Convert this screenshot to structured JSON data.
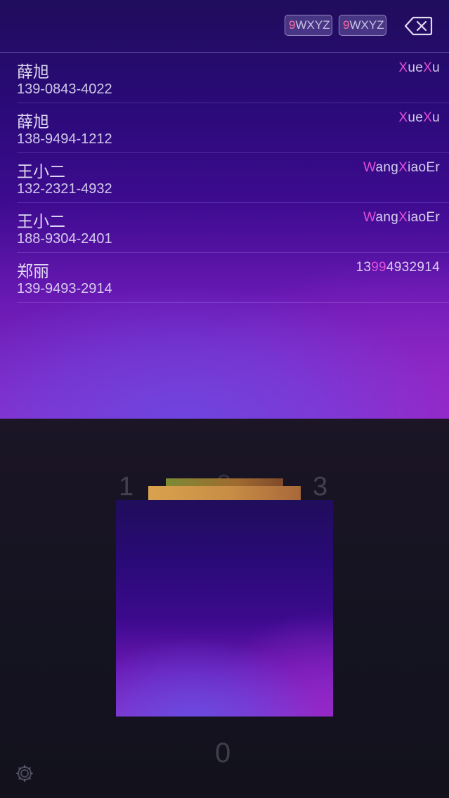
{
  "search": {
    "chips": [
      {
        "highlight": "9",
        "rest": "WXYZ"
      },
      {
        "highlight": "9",
        "rest": "WXYZ"
      }
    ],
    "backspace_icon": "backspace-icon"
  },
  "results": [
    {
      "name": "薛旭",
      "phone": "139-0843-4022",
      "match": [
        {
          "t": "X",
          "hl": true
        },
        {
          "t": "ue",
          "hl": false
        },
        {
          "t": "X",
          "hl": true
        },
        {
          "t": "u",
          "hl": false
        }
      ]
    },
    {
      "name": "薛旭",
      "phone": "138-9494-1212",
      "match": [
        {
          "t": "X",
          "hl": true
        },
        {
          "t": "ue",
          "hl": false
        },
        {
          "t": "X",
          "hl": true
        },
        {
          "t": "u",
          "hl": false
        }
      ]
    },
    {
      "name": "王小二",
      "phone": "132-2321-4932",
      "match": [
        {
          "t": "W",
          "hl": true
        },
        {
          "t": "ang",
          "hl": false
        },
        {
          "t": "X",
          "hl": true
        },
        {
          "t": "iaoEr",
          "hl": false
        }
      ]
    },
    {
      "name": "王小二",
      "phone": "188-9304-2401",
      "match": [
        {
          "t": "W",
          "hl": true
        },
        {
          "t": "ang",
          "hl": false
        },
        {
          "t": "X",
          "hl": true
        },
        {
          "t": "iaoEr",
          "hl": false
        }
      ]
    },
    {
      "name": "郑丽",
      "phone": "139-9493-2914",
      "match": [
        {
          "t": "13",
          "hl": false
        },
        {
          "t": "99",
          "hl": true
        },
        {
          "t": "4932914",
          "hl": false
        }
      ]
    }
  ],
  "keypad": {
    "visible_digits": {
      "one": "1",
      "two": "2",
      "three": "3",
      "zero": "0"
    },
    "settings_icon": "gear-icon"
  },
  "colors": {
    "accent_highlight": "#e04fd8",
    "chip_highlight": "#ff6aa0",
    "gradient_top": "#200d5c",
    "gradient_bottom": "#8a2ac6",
    "keypad_bg": "#141320"
  }
}
